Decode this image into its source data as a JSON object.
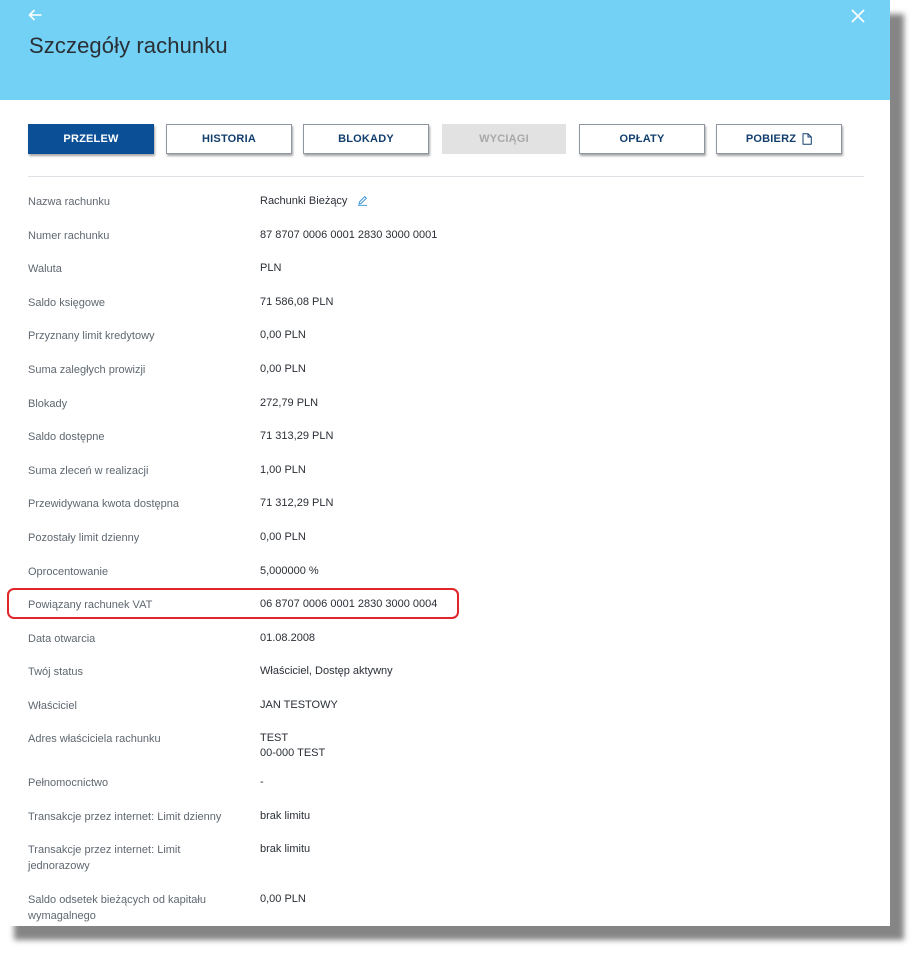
{
  "header": {
    "title": "Szczegóły rachunku"
  },
  "colors": {
    "header_bg": "#72d1f4",
    "primary_button": "#0b4f97",
    "highlight": "#e0262b"
  },
  "icons": {
    "back": "arrow-left-icon",
    "close": "close-icon",
    "edit": "pencil-icon",
    "download": "document-icon"
  },
  "toolbar": {
    "przelew": "PRZELEW",
    "historia": "HISTORIA",
    "blokady": "BLOKADY",
    "wyciagi": "WYCIĄGI",
    "oplaty": "OPŁATY",
    "pobierz": "POBIERZ"
  },
  "details": [
    {
      "label": "Nazwa rachunku",
      "value": "Rachunki Bieżący"
    },
    {
      "label": "Numer rachunku",
      "value": "87 8707 0006 0001 2830 3000 0001"
    },
    {
      "label": "Waluta",
      "value": "PLN"
    },
    {
      "label": "Saldo księgowe",
      "value": "71 586,08  PLN"
    },
    {
      "label": "Przyznany limit kredytowy",
      "value": "0,00  PLN"
    },
    {
      "label": "Suma zaległych prowizji",
      "value": "0,00  PLN"
    },
    {
      "label": "Blokady",
      "value": "272,79  PLN"
    },
    {
      "label": "Saldo dostępne",
      "value": "71 313,29  PLN"
    },
    {
      "label": "Suma zleceń w realizacji",
      "value": "1,00  PLN"
    },
    {
      "label": "Przewidywana kwota dostępna",
      "value": "71 312,29  PLN"
    },
    {
      "label": "Pozostały limit dzienny",
      "value": "0,00  PLN"
    },
    {
      "label": "Oprocentowanie",
      "value": "5,000000 %"
    },
    {
      "label": "Powiązany rachunek VAT",
      "value": "06 8707 0006 0001 2830 3000 0004"
    },
    {
      "label": "Data otwarcia",
      "value": "01.08.2008"
    },
    {
      "label": "Twój status",
      "value": "Właściciel,  Dostęp aktywny"
    },
    {
      "label": "Właściciel",
      "value": "JAN TESTOWY"
    },
    {
      "label": "Adres właściciela rachunku",
      "value": "TEST",
      "value2": "00-000 TEST"
    },
    {
      "label": "Pełnomocnictwo",
      "value": "-"
    },
    {
      "label": "Transakcje przez internet: Limit dzienny",
      "value": "brak limitu"
    },
    {
      "label": "Transakcje przez internet: Limit jednorazowy",
      "value": "brak limitu"
    },
    {
      "label": "Saldo odsetek bieżących od kapitału wymagalnego",
      "value": "0,00  PLN"
    }
  ]
}
